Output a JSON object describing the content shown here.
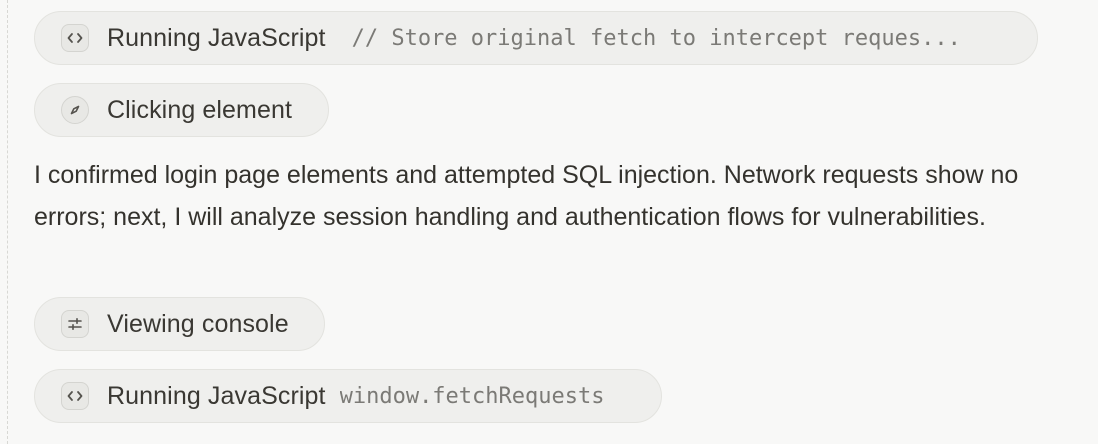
{
  "steps": [
    {
      "icon": "code-icon",
      "label": "Running JavaScript",
      "detail": "// Store original fetch to intercept reques..."
    },
    {
      "icon": "compass-icon",
      "label": "Clicking element",
      "detail": ""
    },
    {
      "icon": "console-icon",
      "label": "Viewing console",
      "detail": ""
    },
    {
      "icon": "code-icon",
      "label": "Running JavaScript",
      "detail": "window.fetchRequests"
    }
  ],
  "message": "I confirmed login page elements and attempted SQL injection. Network requests show no errors; next, I will analyze session handling and authentication flows for vulnerabilities."
}
